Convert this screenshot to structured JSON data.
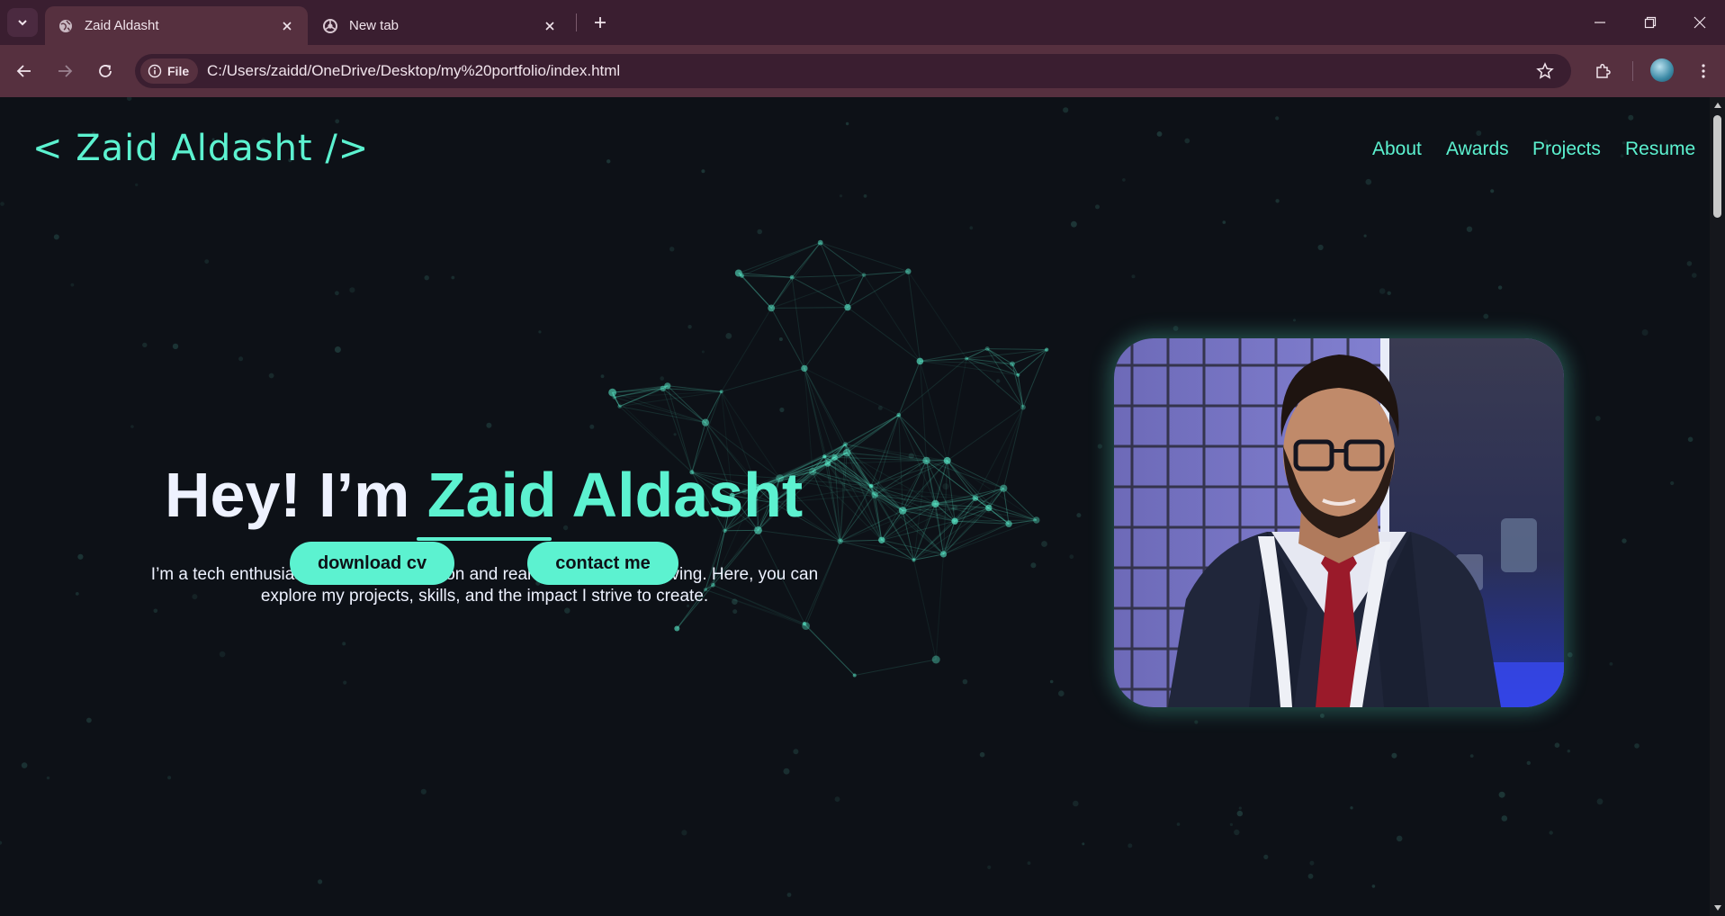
{
  "browser": {
    "tabs": [
      {
        "title": "Zaid Aldasht",
        "active": true,
        "favicon": "globe-icon"
      },
      {
        "title": "New tab",
        "active": false,
        "favicon": "chrome-icon"
      }
    ],
    "address": {
      "chip_label": "File",
      "url": "C:/Users/zaidd/OneDrive/Desktop/my%20portfolio/index.html"
    },
    "colors": {
      "frame": "#3a1e30",
      "toolbar": "#56303f"
    }
  },
  "site": {
    "logo": "< Zaid Aldasht />",
    "nav": [
      "About",
      "Awards",
      "Projects",
      "Resume"
    ],
    "hero": {
      "greeting": "Hey! I’m",
      "name": "Zaid Aldasht",
      "description": "I’m a tech enthusiast driven by innovation and real-world problem solving. Here, you can explore my projects, skills, and the impact I strive to create."
    },
    "buttons": {
      "download": "download cv",
      "contact": "contact me"
    },
    "colors": {
      "accent": "#5cf2d0",
      "background": "#0d1117",
      "text": "#eef2ff"
    }
  }
}
